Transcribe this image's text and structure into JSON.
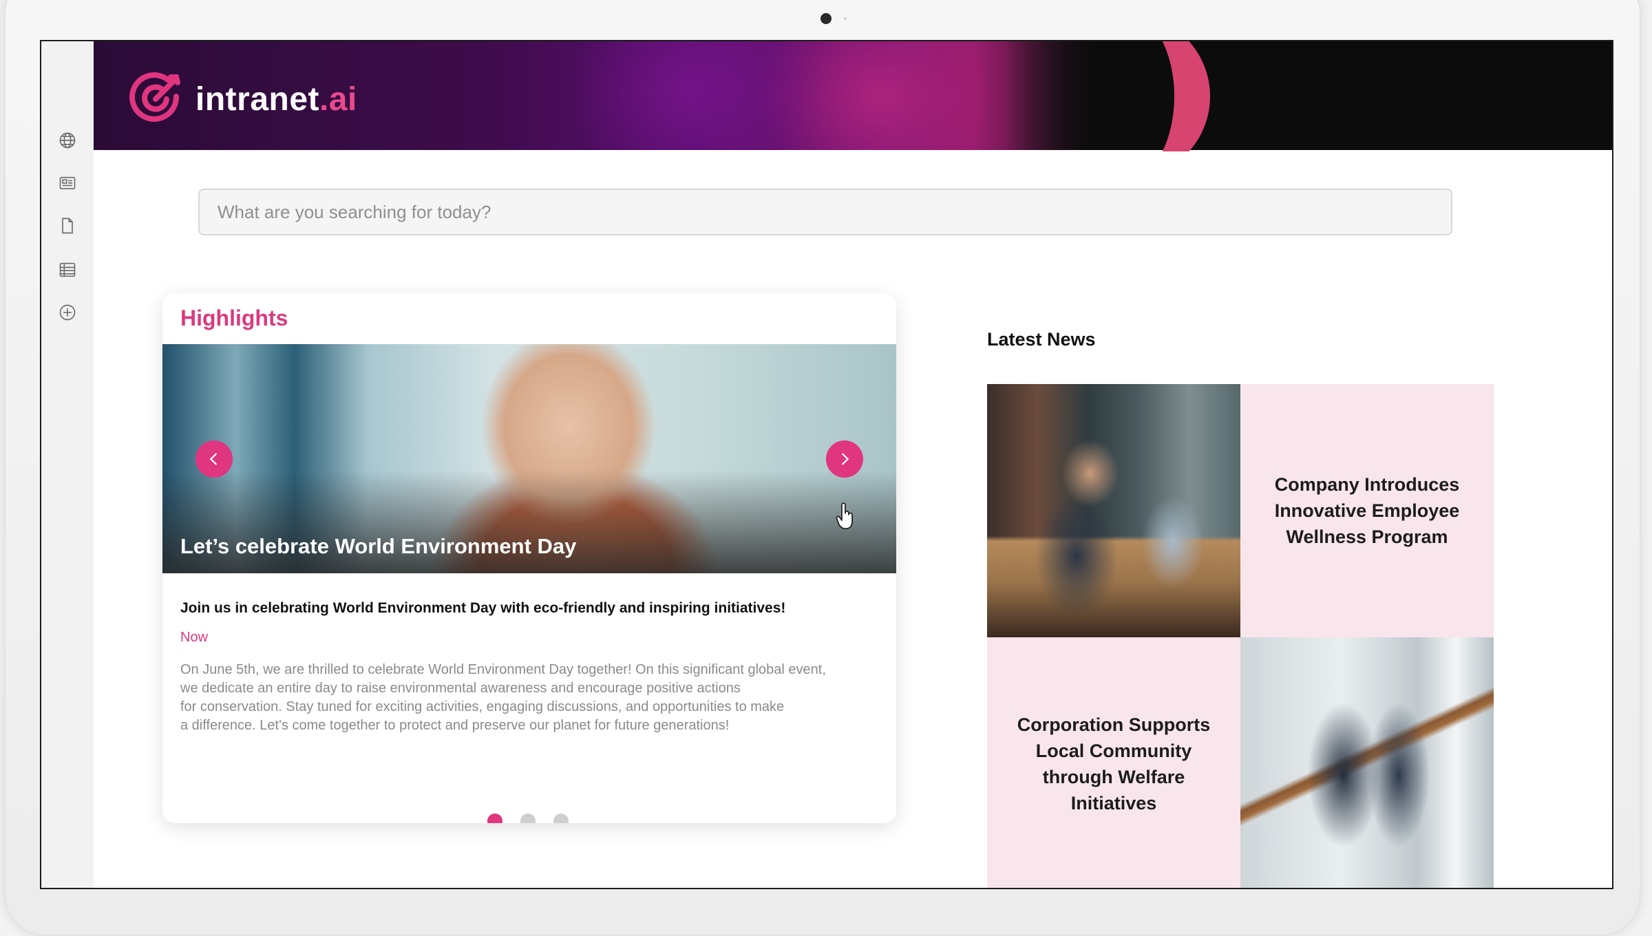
{
  "brand": {
    "name": "intranet",
    "suffix": ".ai",
    "accent": "#e0357f"
  },
  "sidebar": {
    "icons": [
      "globe-icon",
      "newspaper-icon",
      "document-icon",
      "table-icon",
      "add-circle-icon"
    ]
  },
  "search": {
    "placeholder": "What are you searching for today?"
  },
  "highlights": {
    "title": "Highlights",
    "slide_title": "Let’s celebrate World Environment Day",
    "subtitle": "Join us in celebrating World Environment Day with eco-friendly and inspiring initiatives!",
    "time": "Now",
    "body_lines": [
      "On June 5th, we are thrilled to celebrate World Environment Day together! On this significant global event,",
      "we dedicate an entire day to raise environmental awareness and encourage positive actions",
      "for conservation. Stay tuned for exciting activities, engaging discussions, and opportunities to make",
      "a difference. Let's come together to protect and preserve our planet for future generations!"
    ],
    "slides_total": 3,
    "active_slide": 1
  },
  "news": {
    "title": "Latest News",
    "items": [
      {
        "headline": "Company Introduces Innovative Employee Wellness Program"
      },
      {
        "headline": "Corporation Supports Local Community through Welfare Initiatives"
      }
    ]
  }
}
